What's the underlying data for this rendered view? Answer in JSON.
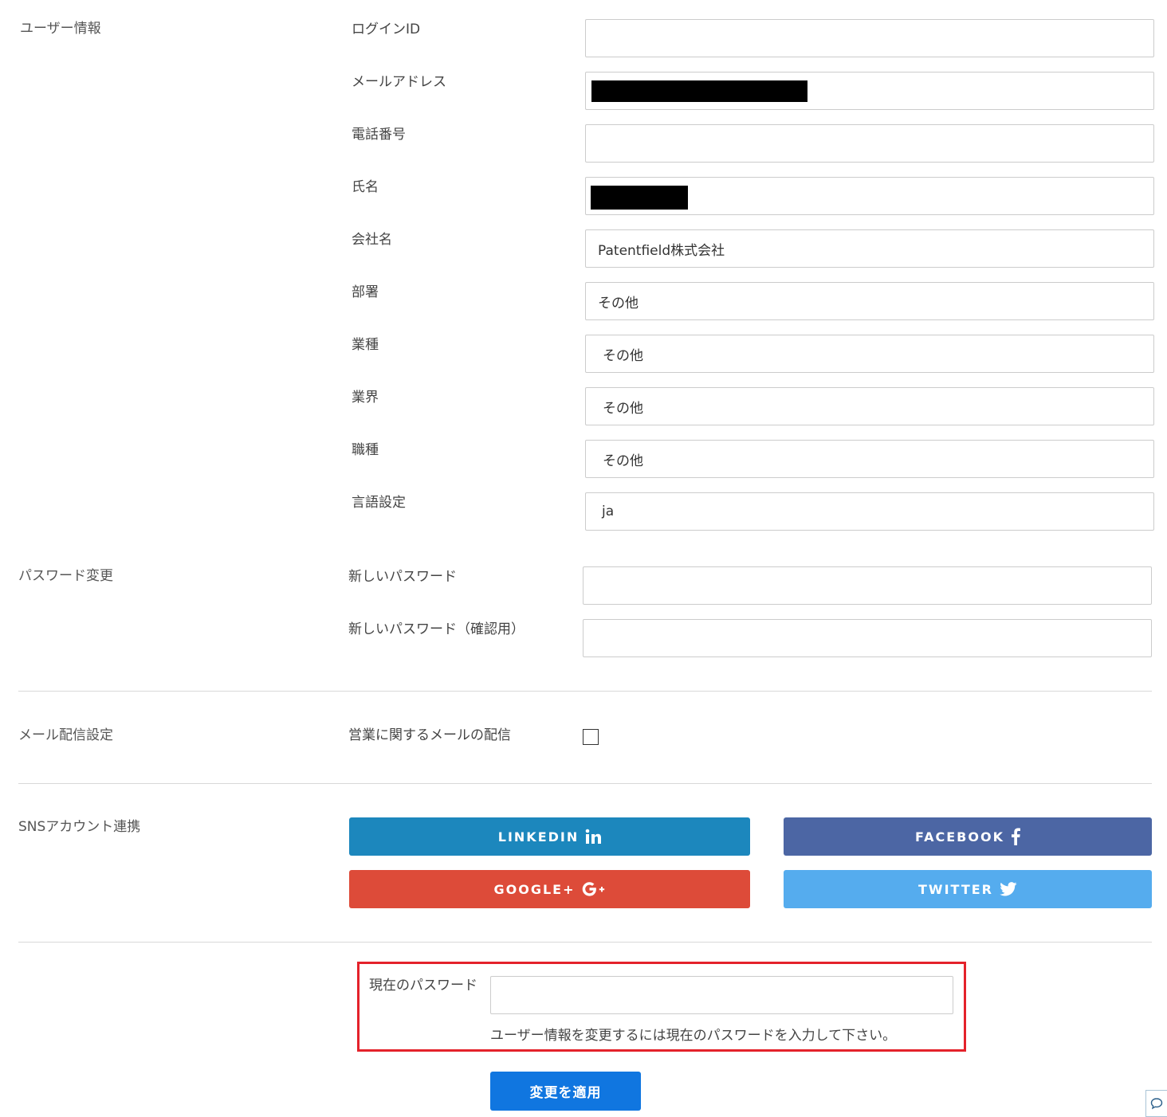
{
  "user_info": {
    "section_label": "ユーザー情報",
    "fields": [
      {
        "label": "ログインID",
        "value": ""
      },
      {
        "label": "メールアドレス",
        "value": ""
      },
      {
        "label": "電話番号",
        "value": ""
      },
      {
        "label": "氏名",
        "value": ""
      },
      {
        "label": "会社名",
        "value": "Patentfield株式会社"
      },
      {
        "label": "部署",
        "value": "その他"
      },
      {
        "label": "業種",
        "value": "その他"
      },
      {
        "label": "業界",
        "value": "その他"
      },
      {
        "label": "職種",
        "value": "その他"
      },
      {
        "label": "言語設定",
        "value": "ja"
      }
    ]
  },
  "password_change": {
    "section_label": "パスワード変更",
    "new_password_label": "新しいパスワード",
    "new_password_value": "",
    "confirm_password_label": "新しいパスワード（確認用）",
    "confirm_password_value": ""
  },
  "mail_settings": {
    "section_label": "メール配信設定",
    "sales_mail_label": "営業に関するメールの配信",
    "sales_mail_checked": false
  },
  "sns": {
    "section_label": "SNSアカウント連携",
    "linkedin_label": "LINKEDIN",
    "facebook_label": "FACEBOOK",
    "google_label": "GOOGLE+",
    "twitter_label": "TWITTER",
    "colors": {
      "linkedin": "#1c87bd",
      "facebook": "#4c66a4",
      "google": "#dd4b39",
      "twitter": "#55acee"
    }
  },
  "current_password": {
    "label": "現在のパスワード",
    "value": "",
    "hint": "ユーザー情報を変更するには現在のパスワードを入力して下さい。",
    "highlight_color": "#e4222b"
  },
  "apply_button": {
    "label": "変更を適用",
    "color": "#1076e0"
  },
  "chat_widget": {
    "icon": "chat-bubble-icon"
  }
}
